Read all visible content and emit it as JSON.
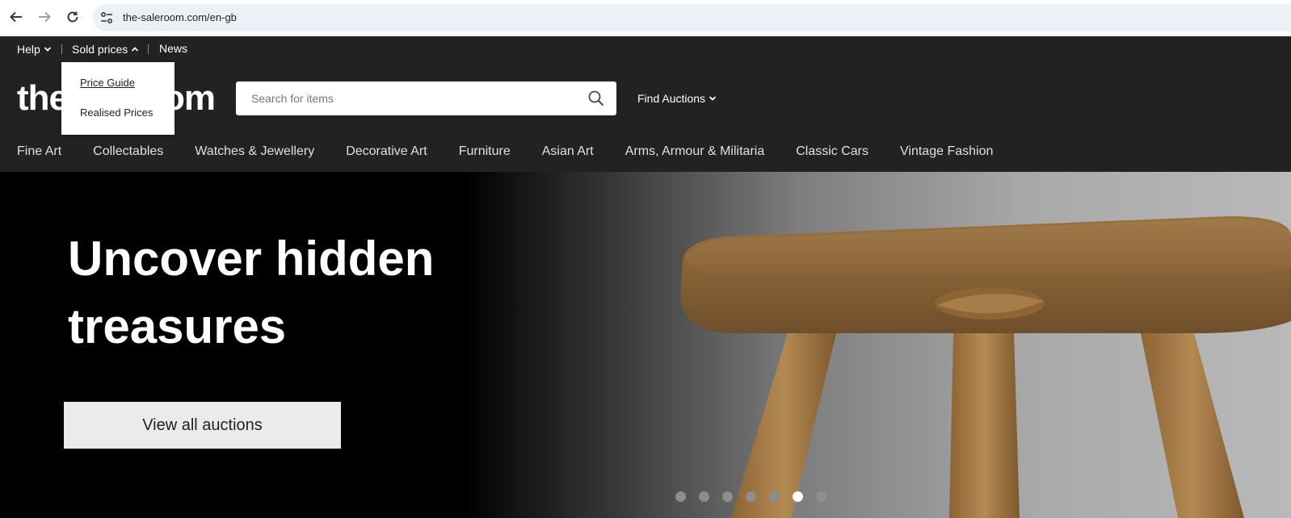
{
  "browser": {
    "url": "the-saleroom.com/en-gb"
  },
  "header": {
    "util": {
      "help": "Help",
      "sold_prices": "Sold prices",
      "news": "News"
    },
    "logo_left": "the",
    "logo_right": "om",
    "search_placeholder": "Search for items",
    "find_auctions": "Find Auctions",
    "categories": [
      "Fine Art",
      "Collectables",
      "Watches & Jewellery",
      "Decorative Art",
      "Furniture",
      "Asian Art",
      "Arms, Armour & Militaria",
      "Classic Cars",
      "Vintage Fashion"
    ]
  },
  "dropdown": {
    "items": [
      "Price Guide",
      "Realised Prices"
    ]
  },
  "hero": {
    "title_line1": "Uncover hidden",
    "title_line2": "treasures",
    "button": "View all auctions",
    "slides_total": 7,
    "active_slide": 6
  }
}
